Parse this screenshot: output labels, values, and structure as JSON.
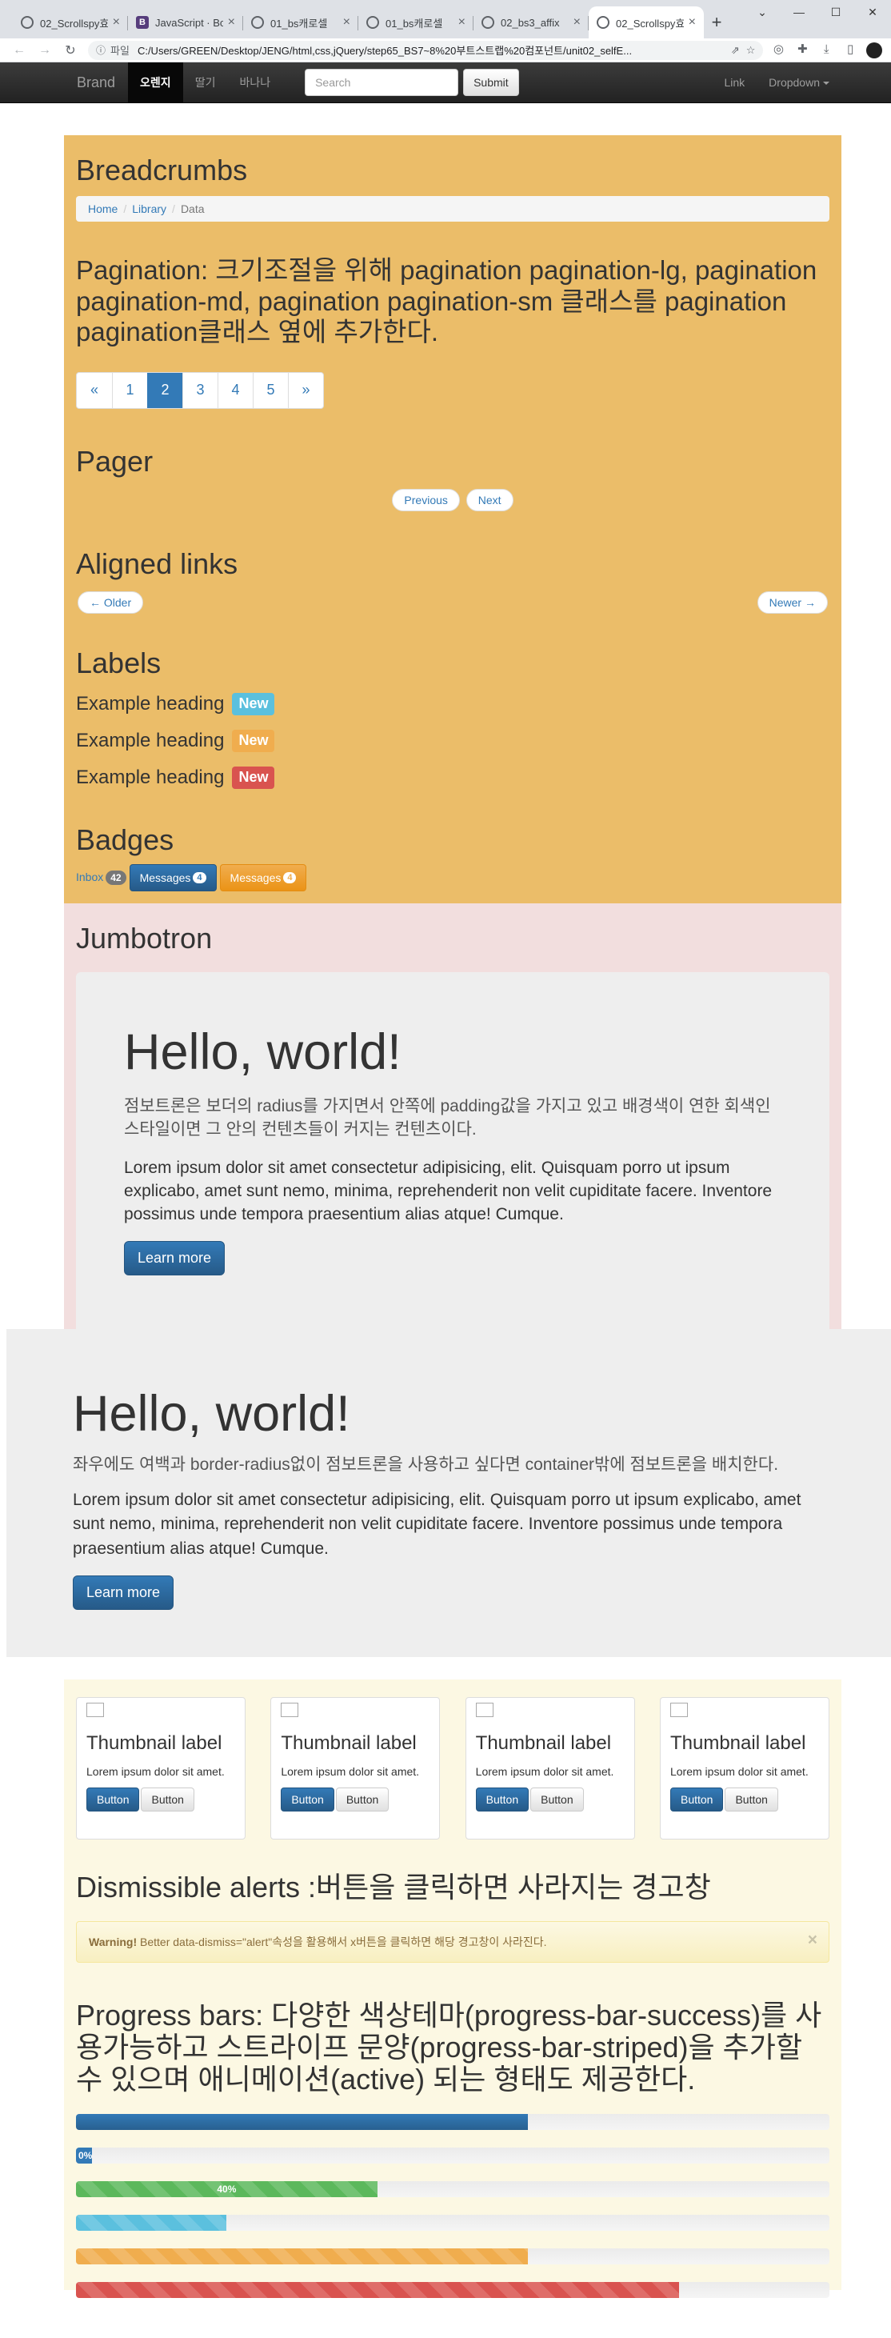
{
  "browser": {
    "tabs": [
      {
        "label": "02_Scrollspy효과",
        "icon": "globe-icon"
      },
      {
        "label": "JavaScript · Bo",
        "icon": "bootstrap-icon"
      },
      {
        "label": "01_bs캐로셀",
        "icon": "globe-icon"
      },
      {
        "label": "01_bs캐로셀",
        "icon": "globe-icon"
      },
      {
        "label": "02_bs3_affix",
        "icon": "globe-icon"
      },
      {
        "label": "02_Scrollspy효과",
        "icon": "globe-icon",
        "active": true
      }
    ],
    "file_label": "파일",
    "url": "C:/Users/GREEN/Desktop/JENG/html,css,jQuery/step65_BS7~8%20부트스트랩%20컴포넌트/unit02_selfE..."
  },
  "navbar": {
    "brand": "Brand",
    "items": [
      "오렌지",
      "딸기",
      "바나나"
    ],
    "active_index": 0,
    "search_placeholder": "Search",
    "submit": "Submit",
    "right_link": "Link",
    "dropdown": "Dropdown"
  },
  "breadcrumbs": {
    "heading": "Breadcrumbs",
    "items": [
      "Home",
      "Library",
      "Data"
    ]
  },
  "pagination": {
    "heading": "Pagination: 크기조절을 위해 pagination pagination-lg, pagination pagination-md, pagination pagination-sm 클래스를 pagination pagination클래스 옆에 추가한다.",
    "items": [
      "«",
      "1",
      "2",
      "3",
      "4",
      "5",
      "»"
    ],
    "active": "2"
  },
  "pager": {
    "heading": "Pager",
    "previous": "Previous",
    "next": "Next"
  },
  "aligned": {
    "heading": "Aligned links",
    "older": "← Older",
    "newer": "Newer →"
  },
  "labels": {
    "heading": "Labels",
    "rows": [
      {
        "text": "Example heading",
        "label": "New",
        "color": "#5bc0de"
      },
      {
        "text": "Example heading",
        "label": "New",
        "color": "#f0ad4e"
      },
      {
        "text": "Example heading",
        "label": "New",
        "color": "#d9534f"
      }
    ]
  },
  "badges": {
    "heading": "Badges",
    "inbox": "Inbox",
    "inbox_count": "42",
    "messages1": "Messages",
    "messages1_count": "4",
    "messages2": "Messages",
    "messages2_count": "4"
  },
  "jumbotron": {
    "heading": "Jumbotron",
    "title": "Hello, world!",
    "desc": "점보트론은 보더의 radius를 가지면서 안쪽에 padding값을 가지고 있고 배경색이 연한 회색인 스타일이면 그 안의 컨텐츠들이 커지는 컨텐츠이다.",
    "lorem": "Lorem ipsum dolor sit amet consectetur adipisicing, elit. Quisquam porro ut ipsum explicabo, amet sunt nemo, minima, reprehenderit non velit cupiditate facere. Inventore possimus unde tempora praesentium alias atque! Cumque.",
    "button": "Learn more"
  },
  "jumbotron_full": {
    "title": "Hello, world!",
    "desc": "좌우에도 여백과 border-radius없이 점보트론을 사용하고 싶다면 container밖에 점보트론을 배치한다.",
    "lorem": "Lorem ipsum dolor sit amet consectetur adipisicing, elit. Quisquam porro ut ipsum explicabo, amet sunt nemo, minima, reprehenderit non velit cupiditate facere. Inventore possimus unde tempora praesentium alias atque! Cumque.",
    "button": "Learn more"
  },
  "thumbnails": [
    {
      "label": "Thumbnail label",
      "text": "Lorem ipsum dolor sit amet.",
      "btn1": "Button",
      "btn2": "Button"
    },
    {
      "label": "Thumbnail label",
      "text": "Lorem ipsum dolor sit amet.",
      "btn1": "Button",
      "btn2": "Button"
    },
    {
      "label": "Thumbnail label",
      "text": "Lorem ipsum dolor sit amet.",
      "btn1": "Button",
      "btn2": "Button"
    },
    {
      "label": "Thumbnail label",
      "text": "Lorem ipsum dolor sit amet.",
      "btn1": "Button",
      "btn2": "Button"
    }
  ],
  "alerts": {
    "heading": "Dismissible alerts :버튼을 클릭하면 사라지는 경고창",
    "strong": "Warning!",
    "text": "Better data-dismiss=\"alert\"속성을 활용해서 x버튼을 클릭하면 해당 경고창이 사라진다.",
    "close": "×"
  },
  "progress": {
    "heading": "Progress bars: 다양한 색상테마(progress-bar-success)를 사용가능하고 스트라이프 문양(progress-bar-striped)을 추가할 수 있으며 애니메이션(active) 되는 형태도 제공한다.",
    "bars": [
      {
        "value": 60,
        "label": "",
        "style": "default"
      },
      {
        "value": 0,
        "label": "0%",
        "style": "default"
      },
      {
        "value": 40,
        "label": "40%",
        "style": "success-striped"
      },
      {
        "value": 20,
        "label": "",
        "style": "info-striped"
      },
      {
        "value": 60,
        "label": "",
        "style": "warning-striped"
      },
      {
        "value": 80,
        "label": "",
        "style": "danger-striped"
      }
    ]
  }
}
